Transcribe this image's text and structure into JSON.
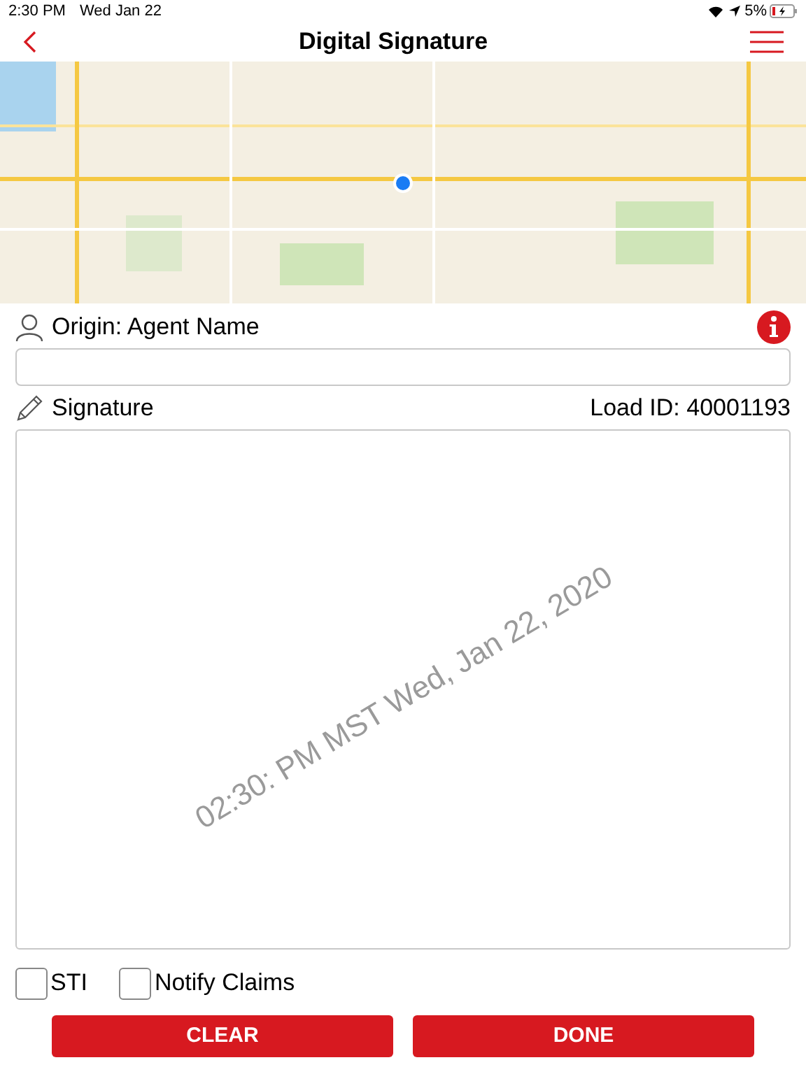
{
  "status_bar": {
    "time": "2:30 PM",
    "date": "Wed Jan 22",
    "battery": "5%"
  },
  "nav": {
    "title": "Digital Signature"
  },
  "origin": {
    "label": "Origin: Agent Name"
  },
  "signature": {
    "label": "Signature",
    "load_id": "Load ID: 40001193",
    "stamp": "02:30: PM MST Wed, Jan 22, 2020"
  },
  "options": [
    {
      "label": "STI",
      "checked": false
    },
    {
      "label": "Notify Claims",
      "checked": false
    }
  ],
  "buttons": [
    "CLEAR",
    "DONE"
  ]
}
